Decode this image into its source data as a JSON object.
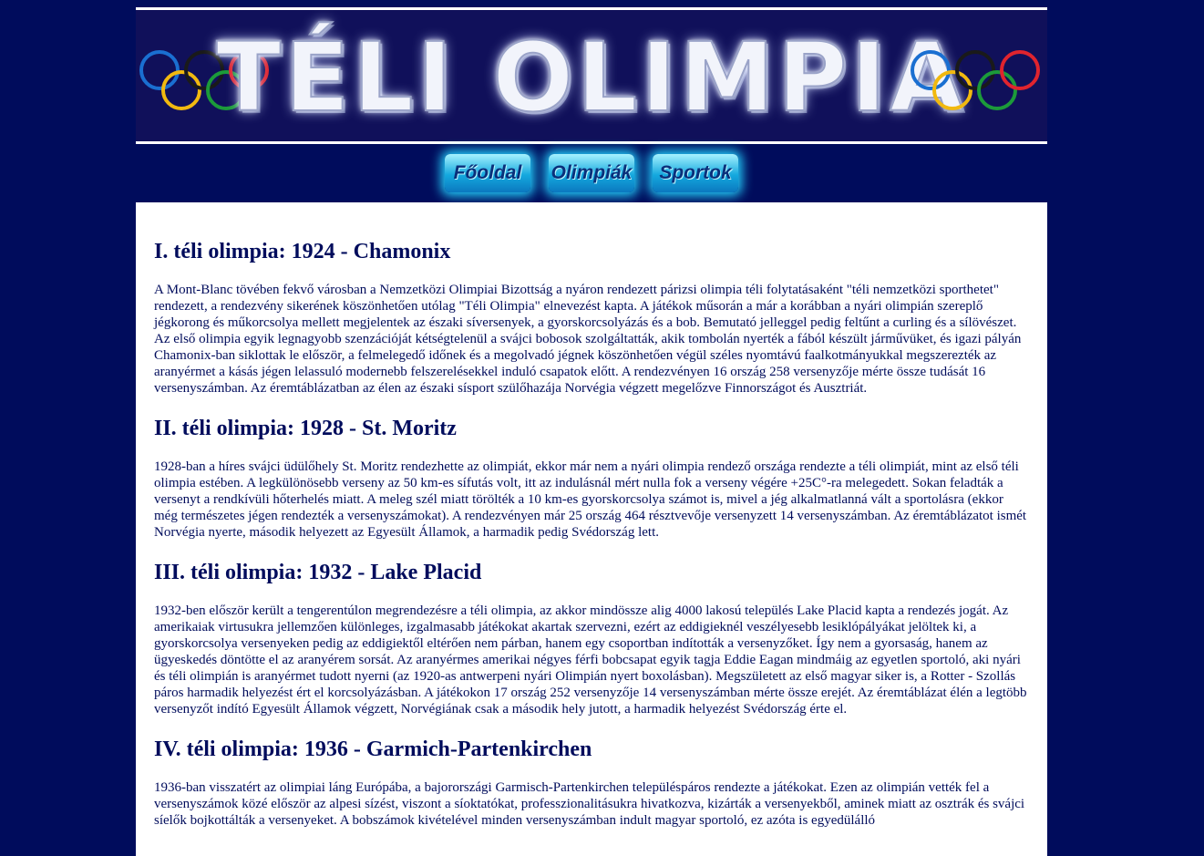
{
  "banner": {
    "title": "TÉLI OLIMPIA",
    "ring_colors": [
      "#1a6fd1",
      "#f1b910",
      "#1a1a1a",
      "#1c9a3a",
      "#e0242e"
    ]
  },
  "nav": {
    "items": [
      {
        "label": "Főoldal"
      },
      {
        "label": "Olimpiák"
      },
      {
        "label": "Sportok"
      }
    ]
  },
  "sections": [
    {
      "title": "I. téli olimpia: 1924 - Chamonix",
      "text": "A Mont-Blanc tövében fekvő városban a Nemzetközi Olimpiai Bizottság a nyáron rendezett párizsi olimpia téli folytatásaként \"téli nemzetközi sporthetet\" rendezett, a rendezvény sikerének köszönhetően utólag \"Téli Olimpia\" elnevezést kapta. A játékok műsorán a már a korábban a nyári olimpián szereplő jégkorong és műkorcsolya mellett megjelentek az északi síversenyek, a gyorskorcsolyázás és a bob. Bemutató jelleggel pedig feltűnt a curling és a sílövészet. Az első olimpia egyik legnagyobb szenzációját kétségtelenül a svájci bobosok szolgáltatták, akik tombolán nyerték a fából készült járművüket, és igazi pályán Chamonix-ban siklottak le először, a felmelegedő időnek és a megolvadó jégnek köszönhetően végül széles nyomtávú faalkotmányukkal megszerezték az aranyérmet a kásás jégen lelassuló modernebb felszerelésekkel induló csapatok előtt. A rendezvényen 16 ország 258 versenyzője mérte össze tudását 16 versenyszámban. Az éremtáblázatban az élen az északi sísport szülőhazája Norvégia végzett megelőzve Finnországot és Ausztriát."
    },
    {
      "title": "II. téli olimpia: 1928 - St. Moritz",
      "text": "1928-ban a híres svájci üdülőhely St. Moritz rendezhette az olimpiát, ekkor már nem a nyári olimpia rendező országa rendezte a téli olimpiát, mint az első téli olimpia estében. A legkülönösebb verseny az 50 km-es sífutás volt, itt az indulásnál mért nulla fok a verseny végére +25C°-ra melegedett. Sokan feladták a versenyt a rendkívüli hőterhelés miatt. A meleg szél miatt törölték a 10 km-es gyorskorcsolya számot is, mivel a jég alkalmatlanná vált a sportolásra (ekkor még természetes jégen rendezték a versenyszámokat). A rendezvényen már 25 ország 464 résztvevője versenyzett 14 versenyszámban. Az éremtáblázatot ismét Norvégia nyerte, második helyezett az Egyesült Államok, a harmadik pedig Svédország lett."
    },
    {
      "title": "III. téli olimpia: 1932 - Lake Placid",
      "text": "1932-ben először került a tengerentúlon megrendezésre a téli olimpia, az akkor mindössze alig 4000 lakosú település Lake Placid kapta a rendezés jogát. Az amerikaiak virtusukra jellemzően különleges, izgalmasabb játékokat akartak szervezni, ezért az eddigieknél veszélyesebb lesiklópályákat jelöltek ki, a gyorskorcsolya versenyeken pedig az eddigiektől eltérően nem párban, hanem egy csoportban indították a versenyzőket. Így nem a gyorsaság, hanem az ügyeskedés döntötte el az aranyérem sorsát. Az aranyérmes amerikai négyes férfi bobcsapat egyik tagja Eddie Eagan mindmáig az egyetlen sportoló, aki nyári és téli olimpián is aranyérmet tudott nyerni (az 1920-as antwerpeni nyári Olimpián nyert boxolásban). Megszületett az első magyar siker is, a Rotter - Szollás páros harmadik helyezést ért el korcsolyázásban. A játékokon 17 ország 252 versenyzője 14 versenyszámban mérte össze erejét. Az éremtáblázat élén a legtöbb versenyzőt indító Egyesült Államok végzett, Norvégiának csak a második hely jutott, a harmadik helyezést Svédország érte el."
    },
    {
      "title": "IV. téli olimpia: 1936 - Garmich-Partenkirchen",
      "text": "1936-ban visszatért az olimpiai láng Európába, a bajorországi Garmisch-Partenkirchen településpáros rendezte a játékokat. Ezen az olimpián vették fel a versenyszámok közé először az alpesi sízést, viszont a síoktatókat, professzionalitásukra hivatkozva, kizárták a versenyekből, aminek miatt az osztrák és svájci síelők bojkottálták a versenyeket. A bobszámok kivételével minden versenyszámban indult magyar sportoló, ez azóta is egyedülálló"
    }
  ]
}
